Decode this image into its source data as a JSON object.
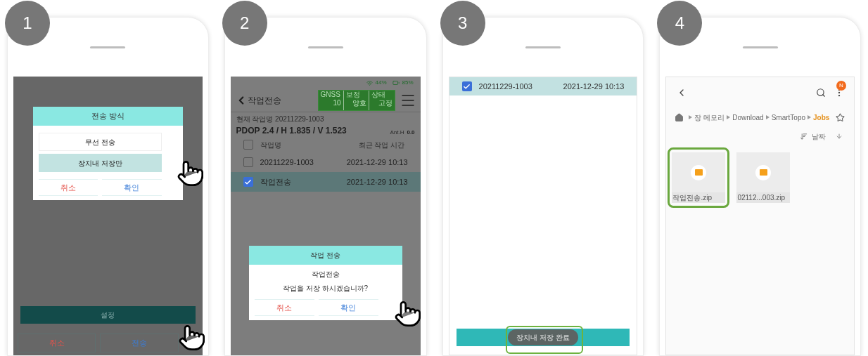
{
  "steps": [
    {
      "number": "1",
      "kind": "method_dialog",
      "dialog": {
        "title": "전송 방식",
        "options": [
          {
            "label": "무선 전송",
            "selected": false
          },
          {
            "label": "장치내 저장만",
            "selected": true
          }
        ],
        "buttons": [
          {
            "label": "취소",
            "kind": "cancel"
          },
          {
            "label": "확인",
            "kind": "confirm"
          }
        ]
      },
      "settings_button": "설정",
      "footer_buttons": [
        {
          "label": "취소",
          "kind": "cancel"
        },
        {
          "label": "전송",
          "kind": "confirm"
        }
      ]
    },
    {
      "number": "2",
      "kind": "job_list",
      "status": {
        "signal": "44%",
        "battery": "85%"
      },
      "title": "작업전송",
      "gnss": [
        {
          "label": "GNSS",
          "value": "10"
        },
        {
          "label": "보정",
          "value": "양호"
        },
        {
          "label": "상태",
          "value": "고정"
        }
      ],
      "current_job": "현재 작업명 20211229-1003",
      "precision": "PDOP 2.4 / H 1.835 / V 1.523",
      "ant_label": "Ant.H",
      "ant_value": "0.0",
      "columns": [
        "작업명",
        "최근 작업 시간"
      ],
      "header_checked": false,
      "rows": [
        {
          "name": "20211229-1003",
          "time": "2021-12-29 10:13",
          "selected": false
        },
        {
          "name": "작업전송",
          "time": "2021-12-29 10:13",
          "selected": true
        }
      ],
      "dialog": {
        "title": "작업 전송",
        "heading": "작업전송",
        "message": "작업을 저장 하시겠습니까?",
        "buttons": [
          {
            "label": "취소",
            "kind": "cancel"
          },
          {
            "label": "확인",
            "kind": "confirm"
          }
        ]
      }
    },
    {
      "number": "3",
      "kind": "saved",
      "rows": [
        {
          "name": "20211229-1003",
          "time": "2021-12-29 10:13",
          "selected": true
        }
      ],
      "toast": "장치내 저장 완료"
    },
    {
      "number": "4",
      "kind": "file_browser",
      "badge": "N",
      "breadcrumb": [
        {
          "label": "장 메모리",
          "current": false
        },
        {
          "label": "Download",
          "current": false
        },
        {
          "label": "SmartTopo",
          "current": false
        },
        {
          "label": "Jobs",
          "current": true
        }
      ],
      "sort_label": "날짜",
      "files": [
        {
          "name": "작업전송.zip",
          "highlighted": true
        },
        {
          "name": "02112...003.zip",
          "highlighted": false
        }
      ]
    }
  ]
}
